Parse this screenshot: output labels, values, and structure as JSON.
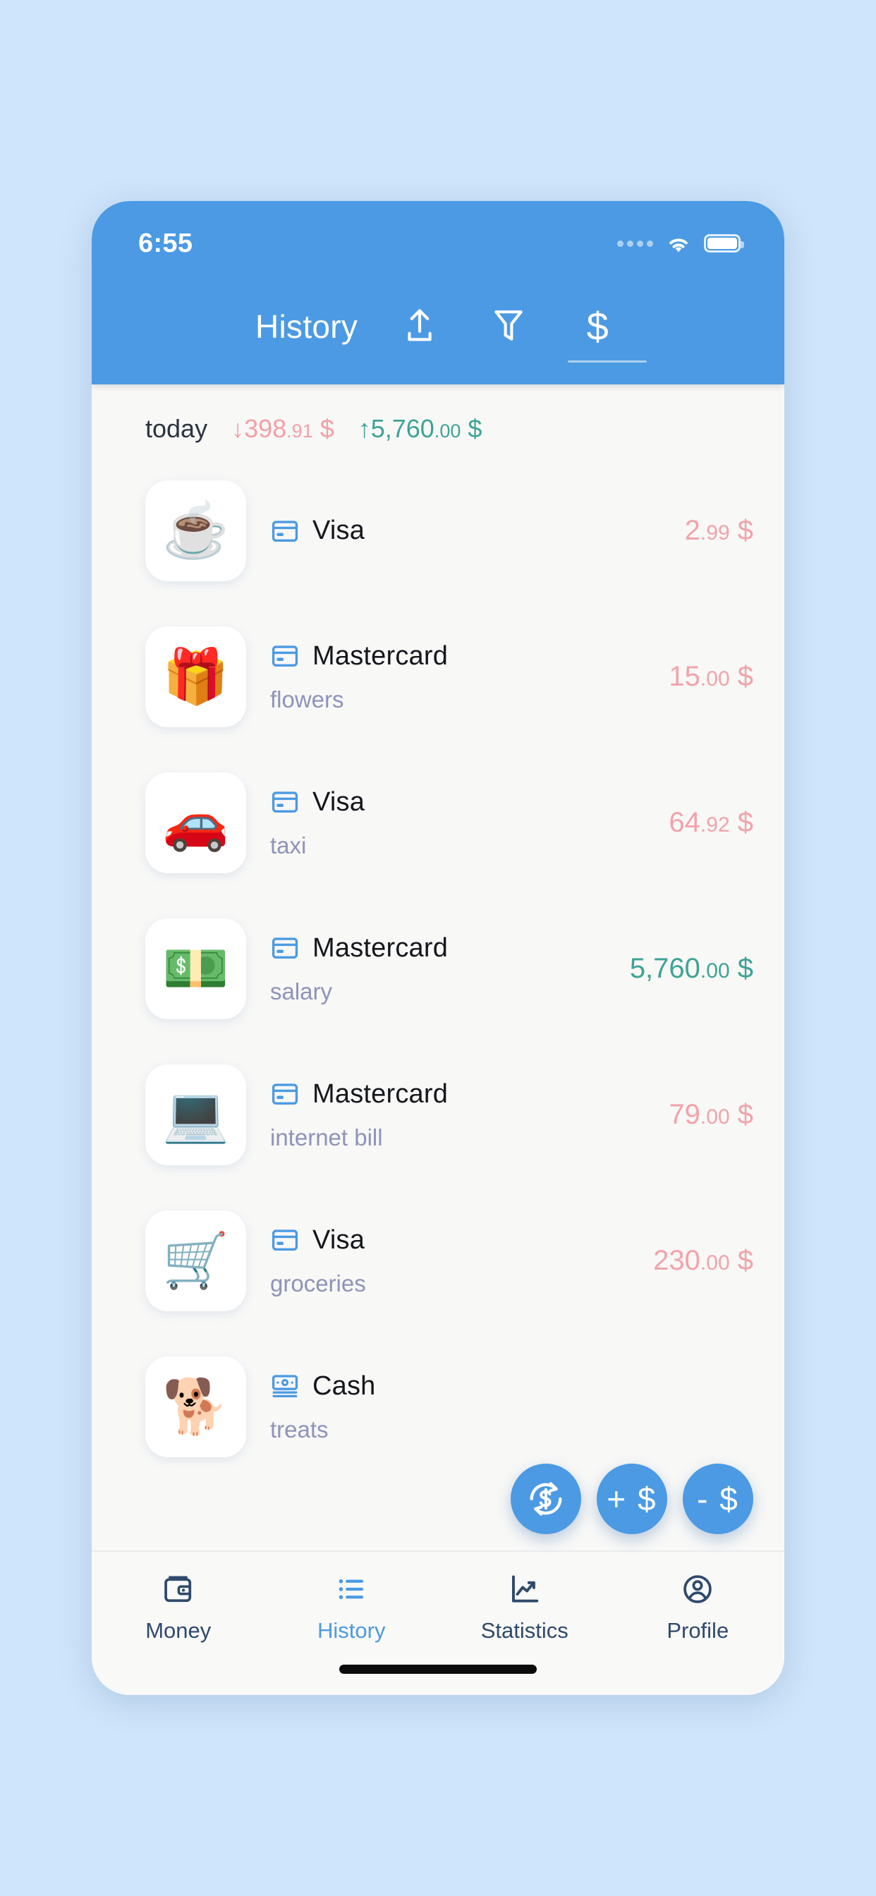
{
  "status_bar": {
    "time": "6:55",
    "signal_icon": "signal-dots-icon",
    "wifi_icon": "wifi-icon",
    "battery_icon": "battery-full-icon"
  },
  "header": {
    "title": "History",
    "actions": [
      {
        "name": "export-icon",
        "label": "export"
      },
      {
        "name": "filter-icon",
        "label": "filter"
      },
      {
        "name": "currency-icon",
        "label": "$",
        "active": true
      }
    ]
  },
  "summary": {
    "label": "today",
    "expense": {
      "arrow": "↓",
      "whole": "398",
      "cents": ".91",
      "currency": " $"
    },
    "income": {
      "arrow": "↑",
      "whole": "5,760",
      "cents": ".00",
      "currency": " $"
    }
  },
  "transactions": [
    {
      "emoji": "☕",
      "emoji_name": "coffee-emoji",
      "account": "Visa",
      "account_icon": "credit-card-icon",
      "note": "",
      "whole": "2",
      "cents": ".99",
      "currency": " $",
      "direction": "neg"
    },
    {
      "emoji": "🎁",
      "emoji_name": "gift-emoji",
      "account": "Mastercard",
      "account_icon": "credit-card-icon",
      "note": "flowers",
      "whole": "15",
      "cents": ".00",
      "currency": " $",
      "direction": "neg"
    },
    {
      "emoji": "🚗",
      "emoji_name": "car-emoji",
      "account": "Visa",
      "account_icon": "credit-card-icon",
      "note": "taxi",
      "whole": "64",
      "cents": ".92",
      "currency": " $",
      "direction": "neg"
    },
    {
      "emoji": "💵",
      "emoji_name": "banknotes-emoji",
      "account": "Mastercard",
      "account_icon": "credit-card-icon",
      "note": "salary",
      "whole": "5,760",
      "cents": ".00",
      "currency": " $",
      "direction": "pos"
    },
    {
      "emoji": "💻",
      "emoji_name": "laptop-emoji",
      "account": "Mastercard",
      "account_icon": "credit-card-icon",
      "note": "internet bill",
      "whole": "79",
      "cents": ".00",
      "currency": " $",
      "direction": "neg"
    },
    {
      "emoji": "🛒",
      "emoji_name": "shopping-cart-emoji",
      "account": "Visa",
      "account_icon": "credit-card-icon",
      "note": "groceries",
      "whole": "230",
      "cents": ".00",
      "currency": " $",
      "direction": "neg"
    },
    {
      "emoji": "🐕",
      "emoji_name": "dog-emoji",
      "account": "Cash",
      "account_icon": "banknote-icon",
      "note": "treats",
      "whole": "",
      "cents": "",
      "currency": "",
      "direction": "neg"
    }
  ],
  "fabs": [
    {
      "name": "transfer-fab",
      "label": "",
      "icon": "transfer-dollar-icon"
    },
    {
      "name": "add-income-fab",
      "label": "+ $",
      "icon": "plus-dollar-icon"
    },
    {
      "name": "add-expense-fab",
      "label": "- $",
      "icon": "minus-dollar-icon"
    }
  ],
  "tabbar": [
    {
      "label": "Money",
      "icon": "wallet-icon",
      "active": false
    },
    {
      "label": "History",
      "icon": "list-icon",
      "active": true
    },
    {
      "label": "Statistics",
      "icon": "line-chart-icon",
      "active": false
    },
    {
      "label": "Profile",
      "icon": "person-icon",
      "active": false
    }
  ],
  "colors": {
    "accent": "#4b9ae3",
    "background": "#cfe5fb",
    "surface": "#f8f8f7",
    "expense": "#f2a3aa",
    "income": "#3ea396",
    "note": "#8f93b8",
    "tab_inactive": "#2f4a6b"
  }
}
